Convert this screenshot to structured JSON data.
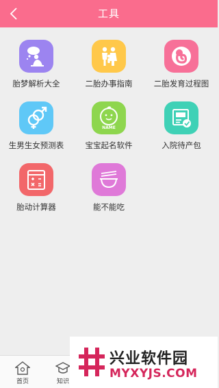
{
  "header": {
    "title": "工具",
    "background": "#fa6c8d"
  },
  "tools": [
    {
      "label": "胎梦解析大全",
      "color": "#9c84f0",
      "icon": "dreaming-person-icon"
    },
    {
      "label": "二胎办事指南",
      "color": "#ffc84a",
      "icon": "family-icon"
    },
    {
      "label": "二胎发育过程图",
      "color": "#f77098",
      "icon": "fetus-icon"
    },
    {
      "label": "生男生女预测表",
      "color": "#5fc8f7",
      "icon": "gender-symbols-icon"
    },
    {
      "label": "宝宝起名软件",
      "color": "#8ed64e",
      "icon": "baby-name-icon"
    },
    {
      "label": "入院待产包",
      "color": "#3fd1b6",
      "icon": "checklist-icon"
    },
    {
      "label": "胎动计算器",
      "color": "#f2676a",
      "icon": "calculator-icon"
    },
    {
      "label": "能不能吃",
      "color": "#df79d8",
      "icon": "bowl-chopsticks-icon"
    }
  ],
  "tabbar": {
    "tabs": [
      {
        "label": "首页",
        "icon": "home-icon"
      },
      {
        "label": "知识",
        "icon": "graduation-cap-icon"
      }
    ]
  },
  "watermark": {
    "title": "兴业软件园",
    "subtitle": "MYXYJS.COM",
    "accent": "#d5265b"
  }
}
